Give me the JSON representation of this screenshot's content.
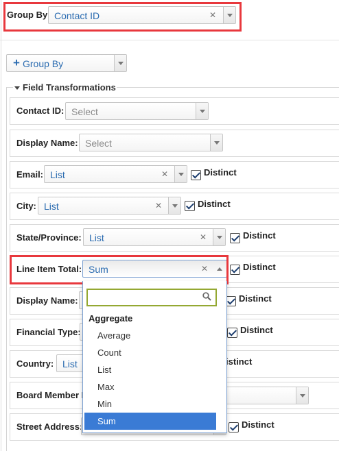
{
  "group_by_top": {
    "label": "Group By",
    "value": "Contact ID"
  },
  "group_by_button": {
    "label": "Group By"
  },
  "fieldset_title": "Field Transformations",
  "distinct_label": "Distinct",
  "fields": [
    {
      "label": "Contact ID:",
      "value": "Select"
    },
    {
      "label": "Display Name:",
      "value": "Select"
    },
    {
      "label": "Email:",
      "value": "List"
    },
    {
      "label": "City:",
      "value": "List"
    },
    {
      "label": "State/Province:",
      "value": "List"
    },
    {
      "label": "Line Item Total:",
      "value": "Sum"
    },
    {
      "label": "Display Name:",
      "value": ""
    },
    {
      "label": "Financial Type:",
      "value": ""
    },
    {
      "label": "Country:",
      "value": "List"
    },
    {
      "label": "Board Member F",
      "value": ""
    },
    {
      "label": "Street Address:",
      "value": ""
    }
  ],
  "distinct_partial": "istinct",
  "dropdown": {
    "group": "Aggregate",
    "options": [
      "Average",
      "Count",
      "List",
      "Max",
      "Min",
      "Sum"
    ],
    "selected": "Sum"
  },
  "colors": {
    "highlight": "#e8383d",
    "value_text": "#2a6bb0",
    "selected_option": "#3a7bd5"
  }
}
